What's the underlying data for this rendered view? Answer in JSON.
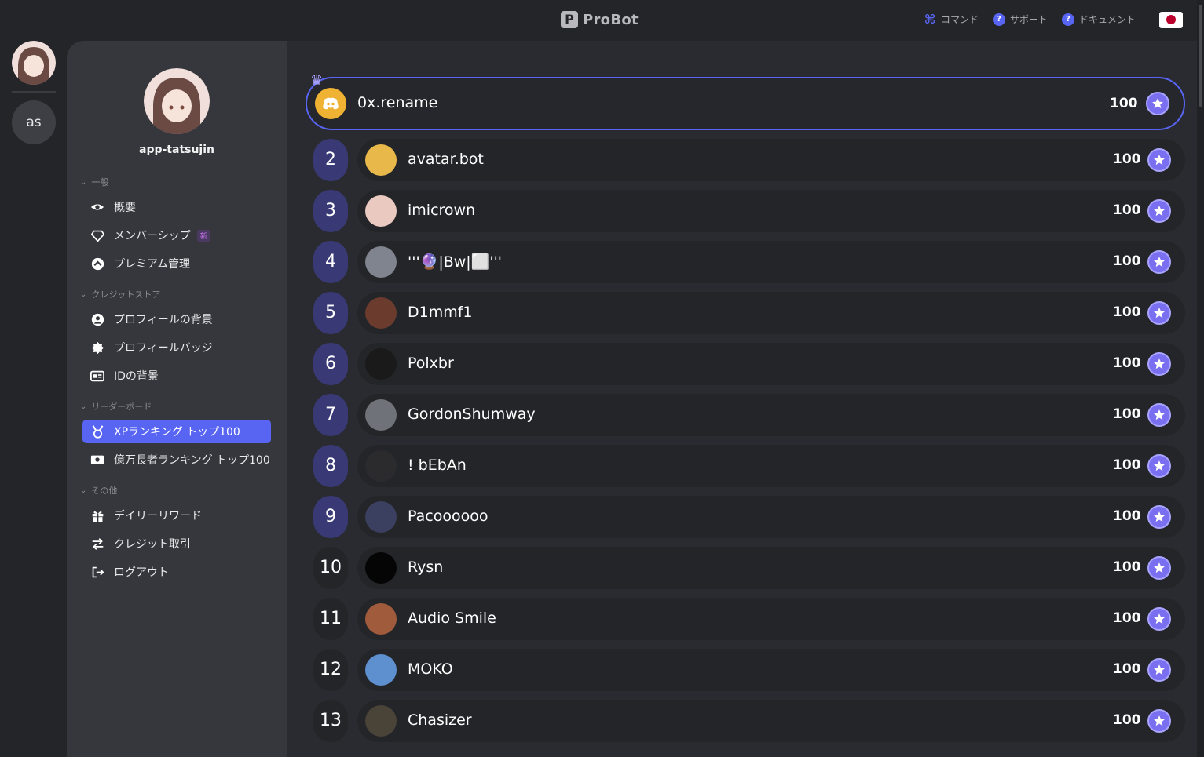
{
  "header": {
    "logo_mark": "P",
    "logo_text": "ProBot",
    "nav": [
      {
        "label": "コマンド",
        "icon": "command-icon"
      },
      {
        "label": "サポート",
        "icon": "help-icon"
      },
      {
        "label": "ドキュメント",
        "icon": "help-icon"
      }
    ],
    "language": "japan-flag-icon"
  },
  "rail": {
    "server_initials": "as"
  },
  "sidebar": {
    "username": "app-tatsujin",
    "sections": [
      {
        "title": "一般",
        "items": [
          {
            "label": "概要",
            "icon": "eye-icon"
          },
          {
            "label": "メンバーシップ",
            "icon": "diamond-icon",
            "badge": "新"
          },
          {
            "label": "プレミアム管理",
            "icon": "chevron-up-circle-icon"
          }
        ]
      },
      {
        "title": "クレジットストア",
        "items": [
          {
            "label": "プロフィールの背景",
            "icon": "user-circle-icon"
          },
          {
            "label": "プロフィールバッジ",
            "icon": "badge-icon"
          },
          {
            "label": "IDの背景",
            "icon": "id-card-icon"
          }
        ]
      },
      {
        "title": "リーダーボード",
        "items": [
          {
            "label": "XPランキング トップ100",
            "icon": "medal-icon",
            "active": true
          },
          {
            "label": "億万長者ランキング トップ100",
            "icon": "money-icon"
          }
        ]
      },
      {
        "title": "その他",
        "items": [
          {
            "label": "デイリーリワード",
            "icon": "gift-icon"
          },
          {
            "label": "クレジット取引",
            "icon": "transfer-icon"
          },
          {
            "label": "ログアウト",
            "icon": "logout-icon"
          }
        ]
      }
    ]
  },
  "leaderboard": {
    "first": {
      "name": "0x.rename",
      "score": "100"
    },
    "rows": [
      {
        "rank": "2",
        "name": "avatar.bot",
        "score": "100",
        "avatar_color": "#e8b84a"
      },
      {
        "rank": "3",
        "name": "imicrown",
        "score": "100",
        "avatar_color": "#e9c9c0"
      },
      {
        "rank": "4",
        "name": "'''🔮|Bw|⬜'''",
        "score": "100",
        "avatar_color": "#80848e"
      },
      {
        "rank": "5",
        "name": "D1mmf1",
        "score": "100",
        "avatar_color": "#6b3b2e"
      },
      {
        "rank": "6",
        "name": "Polxbr",
        "score": "100",
        "avatar_color": "#1a1a1a"
      },
      {
        "rank": "7",
        "name": "GordonShumway",
        "score": "100",
        "avatar_color": "#6f7278"
      },
      {
        "rank": "8",
        "name": "! bEbAn",
        "score": "100",
        "avatar_color": "#2b2b2e"
      },
      {
        "rank": "9",
        "name": "Pacoooooo",
        "score": "100",
        "avatar_color": "#3c4060"
      },
      {
        "rank": "10",
        "name": "Rysn",
        "score": "100",
        "avatar_color": "#050505"
      },
      {
        "rank": "11",
        "name": "Audio Smile",
        "score": "100",
        "avatar_color": "#a05a3c"
      },
      {
        "rank": "12",
        "name": "MOKO",
        "score": "100",
        "avatar_color": "#5e8fcf"
      },
      {
        "rank": "13",
        "name": "Chasizer",
        "score": "100",
        "avatar_color": "#4a4438"
      }
    ]
  },
  "colors": {
    "accent": "#5865f2",
    "star": "#7a6ff0"
  }
}
